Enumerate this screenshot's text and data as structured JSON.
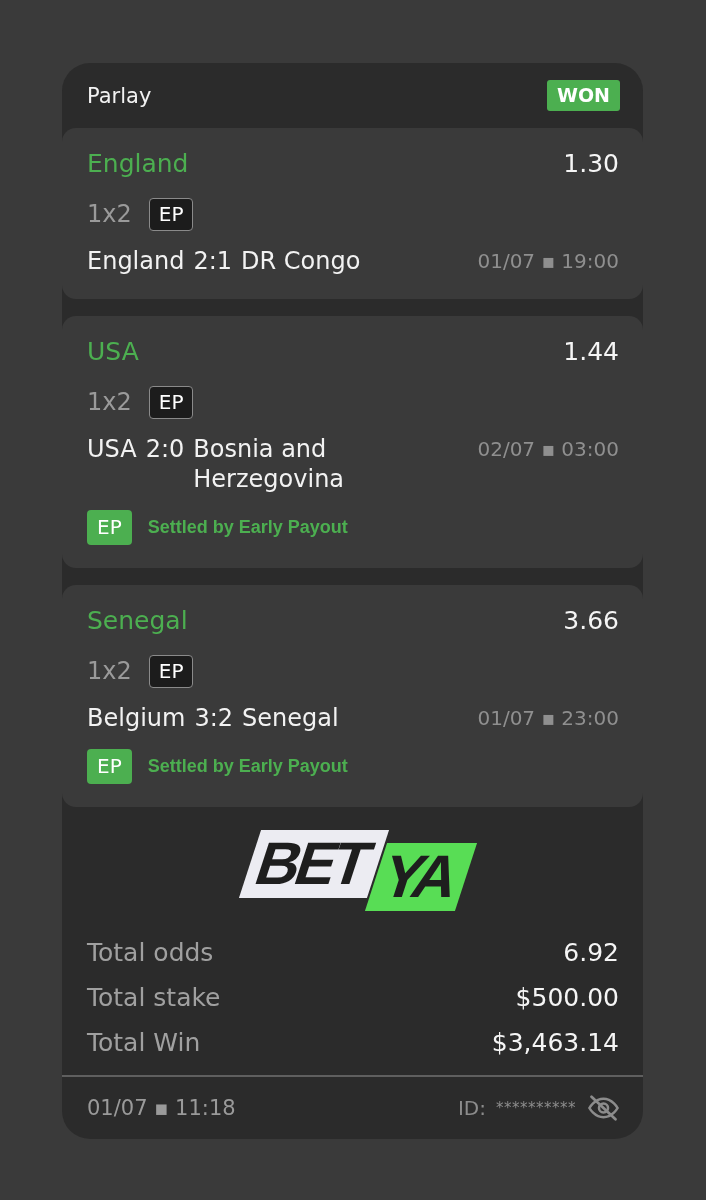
{
  "header": {
    "title": "Parlay",
    "status": {
      "label": "WON",
      "kind": "won"
    }
  },
  "selections": [
    {
      "pick": "England",
      "won": true,
      "odds": "1.30",
      "market": "1x2",
      "tag": "EP",
      "match": {
        "home": "England",
        "score": "2:1",
        "away": "DR Congo"
      },
      "datetime": "01/07 ▪ 19:00"
    },
    {
      "pick": "USA",
      "won": true,
      "odds": "1.44",
      "market": "1x2",
      "tag": "EP",
      "match": {
        "home": "USA",
        "score": "2:0",
        "away": "Bosnia and Herzegovina"
      },
      "datetime": "02/07 ▪ 03:00",
      "settlement": {
        "badge": "EP",
        "text": "Settled by Early Payout"
      }
    },
    {
      "pick": "Senegal",
      "won": true,
      "odds": "3.66",
      "market": "1x2",
      "tag": "EP",
      "match": {
        "home": "Belgium",
        "score": "3:2",
        "away": "Senegal"
      },
      "datetime": "01/07 ▪ 23:00",
      "settlement": {
        "badge": "EP",
        "text": "Settled by Early Payout"
      }
    }
  ],
  "logo": {
    "left": "BET",
    "right": "YA"
  },
  "totals": [
    {
      "label": "Total odds",
      "value": "6.92"
    },
    {
      "label": "Total stake",
      "value": "$500.00"
    },
    {
      "label": "Total Win",
      "value": "$3,463.14"
    }
  ],
  "footer": {
    "datetime": "01/07 ▪ 11:18",
    "id_label": "ID:",
    "id_value": "**********",
    "id_hidden": true
  }
}
